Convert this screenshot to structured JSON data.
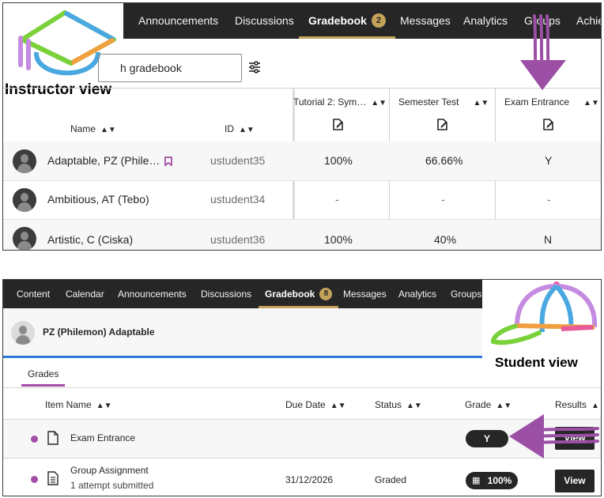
{
  "instructor": {
    "view_label": "Instructor view",
    "nav": [
      {
        "label": "Announcements"
      },
      {
        "label": "Discussions"
      },
      {
        "label": "Gradebook",
        "badge": "2",
        "active": true
      },
      {
        "label": "Messages"
      },
      {
        "label": "Analytics"
      },
      {
        "label": "Groups"
      },
      {
        "label": "Achie"
      }
    ],
    "search_text": "h gradebook",
    "columns": {
      "name": "Name",
      "id": "ID",
      "tutorial": "Tutorial 2: Sym…",
      "semester": "Semester Test",
      "exam": "Exam Entrance"
    },
    "rows": [
      {
        "name": "Adaptable, PZ (Phile…",
        "id": "ustudent35",
        "tutorial": "100%",
        "semester": "66.66%",
        "exam": "Y",
        "flagged": true
      },
      {
        "name": "Ambitious, AT (Tebo)",
        "id": "ustudent34",
        "tutorial": "-",
        "semester": "-",
        "exam": "-"
      },
      {
        "name": "Artistic, C (Ciska)",
        "id": "ustudent36",
        "tutorial": "100%",
        "semester": "40%",
        "exam": "N"
      }
    ]
  },
  "student": {
    "view_label": "Student view",
    "nav": [
      {
        "label": "Content"
      },
      {
        "label": "Calendar"
      },
      {
        "label": "Announcements"
      },
      {
        "label": "Discussions"
      },
      {
        "label": "Gradebook",
        "badge": "8",
        "active": true
      },
      {
        "label": "Messages"
      },
      {
        "label": "Analytics"
      },
      {
        "label": "Groups"
      }
    ],
    "user_name": "PZ (Philemon) Adaptable",
    "grades_tab": "Grades",
    "columns": {
      "item": "Item Name",
      "due": "Due Date",
      "status": "Status",
      "grade": "Grade",
      "results": "Results"
    },
    "rows": [
      {
        "name": "Exam Entrance",
        "sub": "",
        "due": "",
        "status": "",
        "grade": "Y",
        "results": "View"
      },
      {
        "name": "Group Assignment",
        "sub": "1 attempt submitted",
        "due": "31/12/2026",
        "status": "Graded",
        "grade": "100%",
        "results": "View"
      }
    ]
  },
  "colors": {
    "nav_bg": "#262626",
    "active_underline": "#c5a25a",
    "accent_purple": "#a34ea6",
    "arrow_purple": "#9b4fa5",
    "blue_bar": "#2d78d4"
  }
}
